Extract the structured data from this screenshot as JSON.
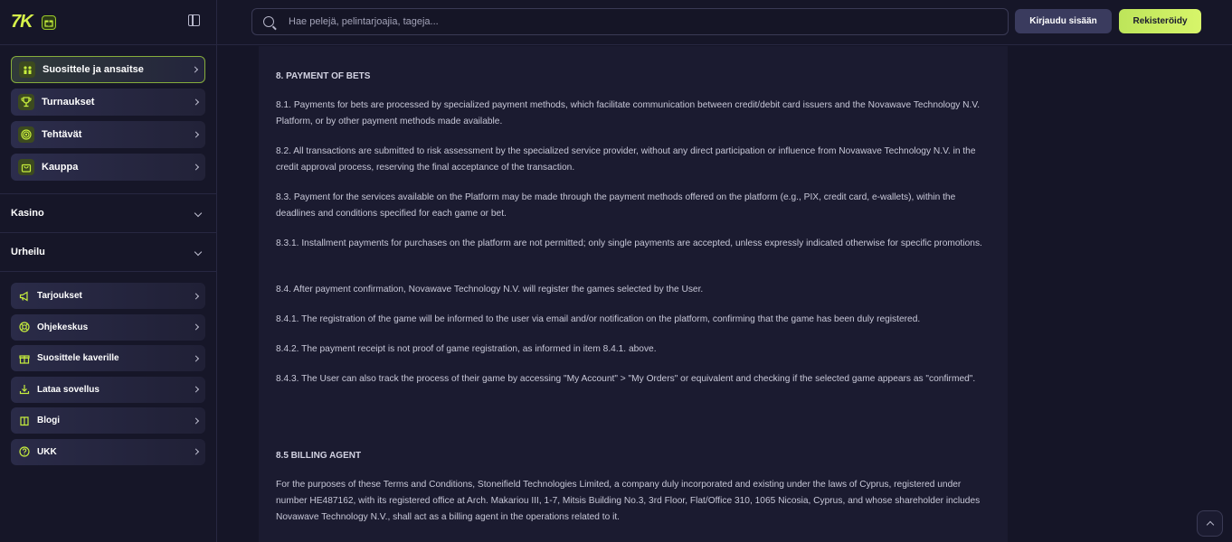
{
  "brand": {
    "logo": "7K"
  },
  "sidebar": {
    "promos": [
      {
        "label": "Suosittele ja ansaitse",
        "icon": "referral-icon"
      },
      {
        "label": "Turnaukset",
        "icon": "trophy-icon"
      },
      {
        "label": "Tehtävät",
        "icon": "target-icon"
      },
      {
        "label": "Kauppa",
        "icon": "shop-bag-icon"
      }
    ],
    "sections": [
      {
        "label": "Kasino"
      },
      {
        "label": "Urheilu"
      }
    ],
    "misc": [
      {
        "label": "Tarjoukset",
        "icon": "megaphone-icon"
      },
      {
        "label": "Ohjekeskus",
        "icon": "lifebuoy-icon"
      },
      {
        "label": "Suosittele kaverille",
        "icon": "gift-icon"
      },
      {
        "label": "Lataa sovellus",
        "icon": "download-icon"
      },
      {
        "label": "Blogi",
        "icon": "book-icon"
      },
      {
        "label": "UKK",
        "icon": "question-icon"
      }
    ]
  },
  "header": {
    "search_placeholder": "Hae pelejä, pelintarjoajia, tageja...",
    "login_label": "Kirjaudu sisään",
    "register_label": "Rekisteröidy"
  },
  "content": {
    "payment_heading": "8. PAYMENT OF BETS",
    "paragraphs": [
      "8.1. Payments for bets are processed by specialized payment methods, which facilitate communication between credit/debit card issuers and the Novawave Technology N.V. Platform, or by other payment methods made available.",
      "8.2. All transactions are submitted to risk assessment by the specialized service provider, without any direct participation or influence from Novawave Technology N.V. in the credit approval process, reserving the final acceptance of the transaction.",
      "8.3. Payment for the services available on the Platform may be made through the payment methods offered on the platform (e.g., PIX, credit card, e-wallets), within the deadlines and conditions specified for each game or bet.",
      "8.3.1. Installment payments for purchases on the platform are not permitted; only single payments are accepted, unless expressly indicated otherwise for specific promotions.",
      "8.4. After payment confirmation, Novawave Technology N.V. will register the games selected by the User.",
      "8.4.1. The registration of the game will be informed to the user via email and/or notification on the platform, confirming that the game has been duly registered.",
      "8.4.2. The payment receipt is not proof of game registration, as informed in item 8.4.1. above.",
      "8.4.3. The User can also track the process of their game by accessing \"My Account\" > \"My Orders\" or equivalent and checking if the selected game appears as \"confirmed\"."
    ],
    "billing_heading": "8.5 BILLING AGENT",
    "billing_paragraph": "For the purposes of these Terms and Conditions, Stoneifield Technologies Limited, a company duly incorporated and existing under the laws of Cyprus, registered under number HE487162, with its registered office at Arch. Makariou III, 1-7, Mitsis Building No.3, 3rd Floor, Flat/Office 310, 1065 Nicosia, Cyprus, and whose shareholder includes Novawave Technology N.V., shall act as a billing agent in the operations related to it."
  },
  "colors": {
    "accent": "#c7ee3d",
    "background": "#151527",
    "panel": "#1b1b30"
  }
}
